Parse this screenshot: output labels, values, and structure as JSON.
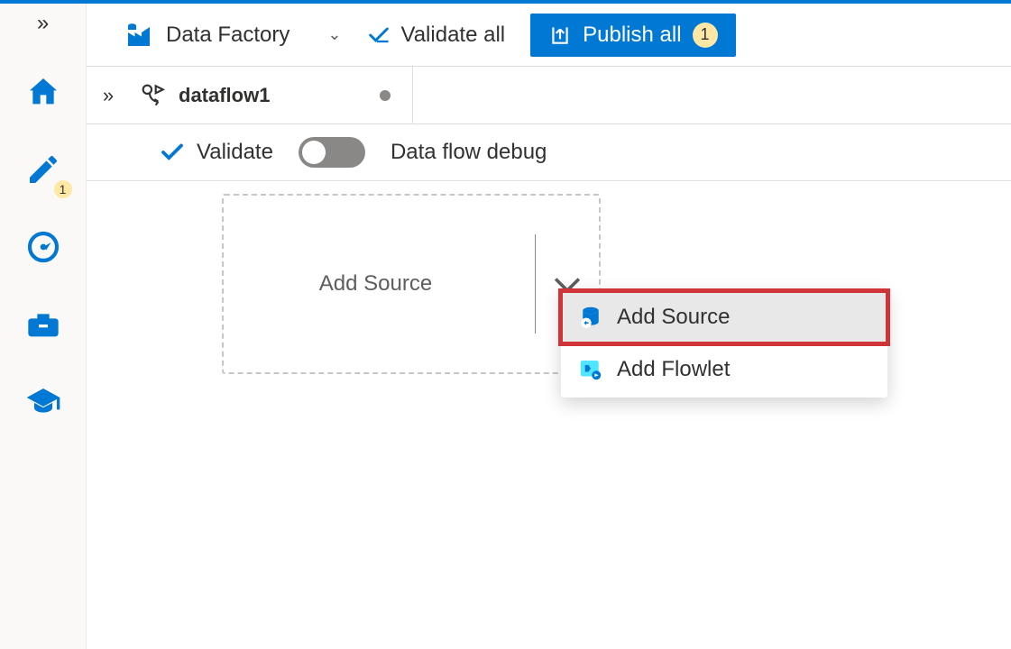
{
  "leftnav": {
    "items": [
      {
        "name": "home"
      },
      {
        "name": "author",
        "badge": "1"
      },
      {
        "name": "monitor"
      },
      {
        "name": "manage"
      },
      {
        "name": "learn"
      }
    ]
  },
  "topbar": {
    "brand_label": "Data Factory",
    "validate_all_label": "Validate all",
    "publish_label": "Publish all",
    "publish_badge": "1"
  },
  "tab": {
    "title": "dataflow1"
  },
  "toolbar": {
    "validate_label": "Validate",
    "debug_label": "Data flow debug"
  },
  "canvas": {
    "add_source_label": "Add Source"
  },
  "menu": {
    "add_source_label": "Add Source",
    "add_flowlet_label": "Add Flowlet"
  }
}
